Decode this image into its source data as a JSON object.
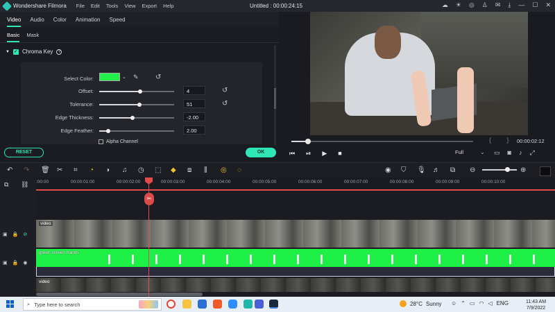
{
  "app": {
    "name": "Wondershare Filmora",
    "project_title": "Untitled : 00:00:24:15",
    "menu": [
      "File",
      "Edit",
      "Tools",
      "View",
      "Export",
      "Help"
    ]
  },
  "editor": {
    "tabs": [
      "Video",
      "Audio",
      "Color",
      "Animation",
      "Speed"
    ],
    "active_tab": "Video",
    "subtabs": [
      "Basic",
      "Mask"
    ],
    "active_subtab": "Basic",
    "chroma_key": {
      "label": "Chroma Key",
      "enabled": true,
      "select_color_label": "Select Color:",
      "selected_color": "#22ef4a",
      "sliders": [
        {
          "label": "Offset:",
          "value": "4",
          "fraction": 0.55
        },
        {
          "label": "Tolerance:",
          "value": "51",
          "fraction": 0.54
        },
        {
          "label": "Edge Thickness:",
          "value": "-2.00",
          "fraction": 0.44
        },
        {
          "label": "Edge Feather:",
          "value": "2.00",
          "fraction": 0.12
        }
      ],
      "alpha_channel_label": "Alpha Channel"
    },
    "reset_label": "RESET",
    "ok_label": "OK"
  },
  "preview": {
    "timecode": "00:00:02:12",
    "quality": "Full",
    "progress": 0.09
  },
  "timeline": {
    "ruler_ticks": [
      ":00:00",
      "00:00:01:00",
      "00:00:02:00",
      "00:00:03:00",
      "00:00:04:00",
      "00:00:05:00",
      "00:00:06:00",
      "00:00:07:00",
      "00:00:08:00",
      "00:00:09:00",
      "00:00:10:00"
    ],
    "tracks": {
      "video_label": "video",
      "green_label": "green screen hands",
      "bottom_label": "video"
    }
  },
  "taskbar": {
    "search_placeholder": "Type here to search",
    "weather_temp": "28°C",
    "weather_desc": "Sunny",
    "language": "ENG",
    "time": "11:43 AM",
    "date": "7/9/2022"
  }
}
